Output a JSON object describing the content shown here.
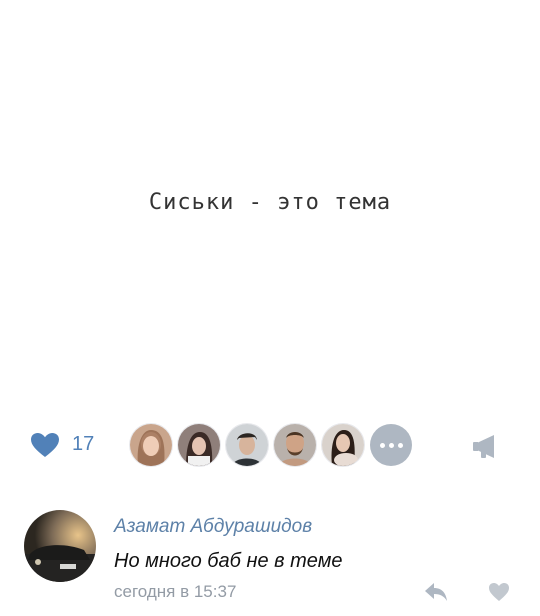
{
  "post": {
    "text": "Сиськи - это тема"
  },
  "actions": {
    "like_count": "17",
    "liked_by": [
      {
        "icon": "avatar-girl-1"
      },
      {
        "icon": "avatar-girl-2"
      },
      {
        "icon": "avatar-boy-1"
      },
      {
        "icon": "avatar-man-1"
      },
      {
        "icon": "avatar-girl-3"
      }
    ],
    "more_icon": "more-dots-icon",
    "share_icon": "megaphone-icon",
    "like_icon": "heart-icon"
  },
  "comment": {
    "author": "Азамат Абдурашидов",
    "text": "Но много баб не в теме",
    "time": "сегодня в 15:37",
    "reply_icon": "reply-icon",
    "like_icon": "heart-icon"
  },
  "colors": {
    "accent": "#5181b8",
    "author": "#5d81a8",
    "muted": "#939ba5"
  }
}
